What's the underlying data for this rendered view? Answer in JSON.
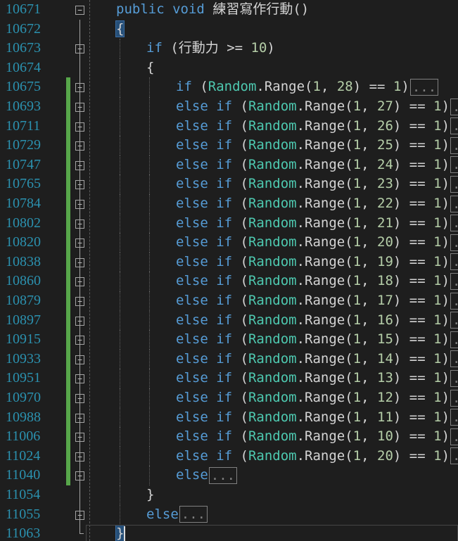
{
  "editor": {
    "colors": {
      "background": "#1e1e1e",
      "line_number": "#2b91af",
      "keyword": "#569cd6",
      "type": "#4ec9b0",
      "number": "#b5cea8",
      "text": "#d4d4d4",
      "change_marker": "#57a64a"
    },
    "collapsed_marker": "...",
    "lines": [
      {
        "num": "10671",
        "fold": "minus",
        "changed": false,
        "indent": 0,
        "kind": "method",
        "kw1": "public",
        "kw2": "void",
        "name": "練習寫作行動()"
      },
      {
        "num": "10672",
        "fold": "none",
        "changed": false,
        "indent": 0,
        "kind": "brace",
        "text": "{"
      },
      {
        "num": "10673",
        "fold": "minus",
        "changed": false,
        "indent": 1,
        "kind": "if_plain",
        "kw": "if",
        "text_before": " (行動力 >= ",
        "value": "10",
        "text_after": ")"
      },
      {
        "num": "10674",
        "fold": "none",
        "changed": false,
        "indent": 1,
        "kind": "brace",
        "text": "{"
      },
      {
        "num": "10675",
        "fold": "plus",
        "changed": true,
        "indent": 2,
        "kind": "if_random",
        "kw": "if",
        "max": "28"
      },
      {
        "num": "10693",
        "fold": "plus",
        "changed": true,
        "indent": 2,
        "kind": "elseif_random",
        "kw": "else if",
        "max": "27"
      },
      {
        "num": "10711",
        "fold": "plus",
        "changed": true,
        "indent": 2,
        "kind": "elseif_random",
        "kw": "else if",
        "max": "26"
      },
      {
        "num": "10729",
        "fold": "plus",
        "changed": true,
        "indent": 2,
        "kind": "elseif_random",
        "kw": "else if",
        "max": "25"
      },
      {
        "num": "10747",
        "fold": "plus",
        "changed": true,
        "indent": 2,
        "kind": "elseif_random",
        "kw": "else if",
        "max": "24"
      },
      {
        "num": "10765",
        "fold": "plus",
        "changed": true,
        "indent": 2,
        "kind": "elseif_random",
        "kw": "else if",
        "max": "23"
      },
      {
        "num": "10784",
        "fold": "plus",
        "changed": true,
        "indent": 2,
        "kind": "elseif_random",
        "kw": "else if",
        "max": "22"
      },
      {
        "num": "10802",
        "fold": "plus",
        "changed": true,
        "indent": 2,
        "kind": "elseif_random",
        "kw": "else if",
        "max": "21"
      },
      {
        "num": "10820",
        "fold": "plus",
        "changed": true,
        "indent": 2,
        "kind": "elseif_random",
        "kw": "else if",
        "max": "20"
      },
      {
        "num": "10838",
        "fold": "plus",
        "changed": true,
        "indent": 2,
        "kind": "elseif_random",
        "kw": "else if",
        "max": "19"
      },
      {
        "num": "10860",
        "fold": "plus",
        "changed": true,
        "indent": 2,
        "kind": "elseif_random",
        "kw": "else if",
        "max": "18"
      },
      {
        "num": "10879",
        "fold": "plus",
        "changed": true,
        "indent": 2,
        "kind": "elseif_random",
        "kw": "else if",
        "max": "17"
      },
      {
        "num": "10897",
        "fold": "plus",
        "changed": true,
        "indent": 2,
        "kind": "elseif_random",
        "kw": "else if",
        "max": "16"
      },
      {
        "num": "10915",
        "fold": "plus",
        "changed": true,
        "indent": 2,
        "kind": "elseif_random",
        "kw": "else if",
        "max": "15"
      },
      {
        "num": "10933",
        "fold": "plus",
        "changed": true,
        "indent": 2,
        "kind": "elseif_random",
        "kw": "else if",
        "max": "14"
      },
      {
        "num": "10951",
        "fold": "plus",
        "changed": true,
        "indent": 2,
        "kind": "elseif_random",
        "kw": "else if",
        "max": "13"
      },
      {
        "num": "10970",
        "fold": "plus",
        "changed": true,
        "indent": 2,
        "kind": "elseif_random",
        "kw": "else if",
        "max": "12"
      },
      {
        "num": "10988",
        "fold": "plus",
        "changed": true,
        "indent": 2,
        "kind": "elseif_random",
        "kw": "else if",
        "max": "11"
      },
      {
        "num": "11006",
        "fold": "plus",
        "changed": true,
        "indent": 2,
        "kind": "elseif_random",
        "kw": "else if",
        "max": "10"
      },
      {
        "num": "11024",
        "fold": "plus",
        "changed": true,
        "indent": 2,
        "kind": "elseif_random",
        "kw": "else if",
        "max": "20"
      },
      {
        "num": "11040",
        "fold": "plus",
        "changed": true,
        "indent": 2,
        "kind": "else_collapsed",
        "kw": "else"
      },
      {
        "num": "11054",
        "fold": "none",
        "changed": false,
        "indent": 1,
        "kind": "brace",
        "text": "}"
      },
      {
        "num": "11055",
        "fold": "plus",
        "changed": false,
        "indent": 1,
        "kind": "else_collapsed",
        "kw": "else"
      },
      {
        "num": "11063",
        "fold": "end",
        "changed": false,
        "indent": 0,
        "kind": "brace_hl",
        "text": "}"
      }
    ],
    "random_call": {
      "type_name": "Random",
      "method": ".Range(",
      "min": "1",
      "sep": ", ",
      "close": ") == ",
      "cmp": "1",
      "paren_close": ")"
    }
  }
}
